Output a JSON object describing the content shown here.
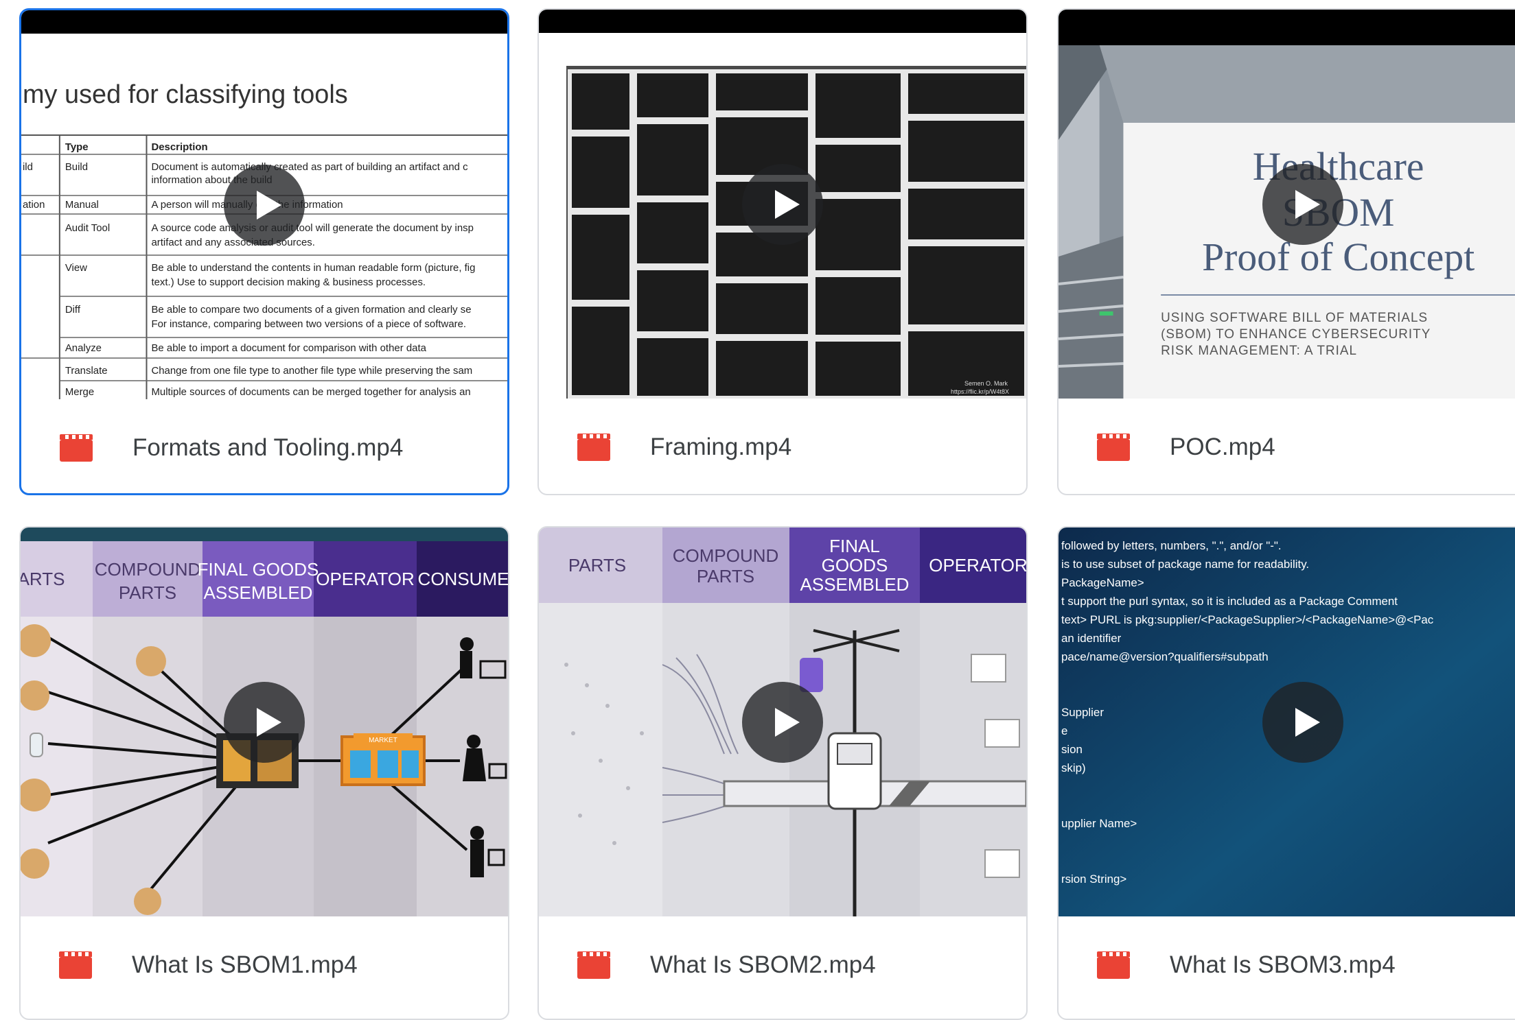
{
  "files": [
    {
      "name": "Formats and Tooling.mp4",
      "selected": true,
      "thumb": {
        "title": "my used for classifying tools",
        "headers": [
          "Type",
          "Description"
        ],
        "rows": [
          [
            "ild",
            "Build",
            "Document is automatically created as part of building an artifact and c"
          ],
          [
            "",
            "",
            "information about the build"
          ],
          [
            "ation",
            "Manual",
            "A person will manually edit the information"
          ],
          [
            "",
            "Audit Tool",
            "A source code analysis or audit tool will generate the document by insp"
          ],
          [
            "",
            "",
            "artifact and any associated sources."
          ],
          [
            "",
            "View",
            "Be able to understand the contents in human readable form (picture, fig"
          ],
          [
            "",
            "",
            "text.) Use to support decision making & business processes."
          ],
          [
            "",
            "Diff",
            "Be able to compare two documents of a given formation and clearly se"
          ],
          [
            "",
            "",
            "For instance, comparing between two versions of a piece of software."
          ],
          [
            "",
            "Analyze",
            "Be able to import a document for comparison with other data"
          ],
          [
            "",
            "Translate",
            "Change from one file type to another file type while preserving the sam"
          ],
          [
            "",
            "Merge",
            "Multiple sources of documents can be merged together for analysis an"
          ]
        ]
      }
    },
    {
      "name": "Framing.mp4",
      "selected": false,
      "thumb": {
        "credit_1": "Semen O. Mark",
        "credit_2": "https://flic.kr/p/W4t8X"
      }
    },
    {
      "name": "POC.mp4",
      "selected": false,
      "thumb": {
        "title_1": "Healthcare",
        "title_2": "SBOM",
        "title_3": "Proof of Concept",
        "subtitle_1": "USING SOFTWARE BILL OF MATERIALS",
        "subtitle_2": "(SBOM) TO ENHANCE CYBERSECURITY",
        "subtitle_3": "RISK MANAGEMENT: A TRIAL"
      }
    },
    {
      "name": "What Is SBOM1.mp4",
      "selected": false,
      "thumb": {
        "columns": [
          {
            "label_1": "ARTS",
            "label_2": ""
          },
          {
            "label_1": "COMPOUND",
            "label_2": "PARTS"
          },
          {
            "label_1": "FINAL GOODS",
            "label_2": "ASSEMBLED"
          },
          {
            "label_1": "OPERATOR",
            "label_2": ""
          },
          {
            "label_1": "CONSUME",
            "label_2": ""
          }
        ],
        "market_sign": "MARKET"
      }
    },
    {
      "name": "What Is SBOM2.mp4",
      "selected": false,
      "thumb": {
        "columns": [
          {
            "label_1": "PARTS",
            "label_2": "",
            "label_3": ""
          },
          {
            "label_1": "COMPOUND",
            "label_2": "PARTS",
            "label_3": ""
          },
          {
            "label_1": "FINAL",
            "label_2": "GOODS",
            "label_3": "ASSEMBLED"
          },
          {
            "label_1": "OPERATOR",
            "label_2": "",
            "label_3": ""
          }
        ]
      }
    },
    {
      "name": "What Is SBOM3.mp4",
      "selected": false,
      "thumb": {
        "lines": [
          "followed by letters, numbers, \".\", and/or \"-\".",
          "is to use subset of package name for readability.",
          "PackageName>",
          "t support the purl syntax, so it is included as a Package Comment",
          "text> PURL is pkg:supplier/<PackageSupplier>/<PackageName>@<Pac",
          "an identifier",
          "pace/name@version?qualifiers#subpath",
          "",
          "Supplier",
          "e",
          "sion",
          "skip)",
          "",
          "upplier Name>",
          "",
          "rsion String>"
        ]
      }
    }
  ],
  "colors": {
    "selected_border": "#1a73e8",
    "video_icon": "#ea4335",
    "file_name_text": "#3c4043"
  },
  "icons": {
    "file_type": "video-file-icon",
    "play": "play-icon"
  }
}
